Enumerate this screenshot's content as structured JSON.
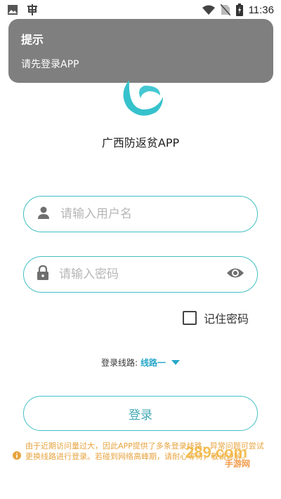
{
  "status_bar": {
    "time": "11:36",
    "icons": [
      "image-icon",
      "bug-icon",
      "wifi-icon",
      "no-sim-icon",
      "battery-charging-icon"
    ]
  },
  "toast": {
    "title": "提示",
    "message": "请先登录APP"
  },
  "app": {
    "name": "广西防返贫APP",
    "logo_icon": "app-logo",
    "accent_color": "#42bfc4"
  },
  "login_form": {
    "username_placeholder": "请输入用户名",
    "username_value": "",
    "password_placeholder": "请输入密码",
    "password_value": "",
    "remember_label": "记住密码",
    "remember_checked": false,
    "route_label": "登录线路:",
    "route_value": "线路一",
    "submit_label": "登录"
  },
  "notice": {
    "text": "由于近期访问量过大，因此APP提供了多条登录线路，异常问题可尝试更换线路进行登录。若碰到网络高峰期，请耐心等待，敬请谅解。",
    "color": "#e7a33f"
  },
  "watermark": {
    "text": "289.com",
    "subtext": "手游网"
  }
}
